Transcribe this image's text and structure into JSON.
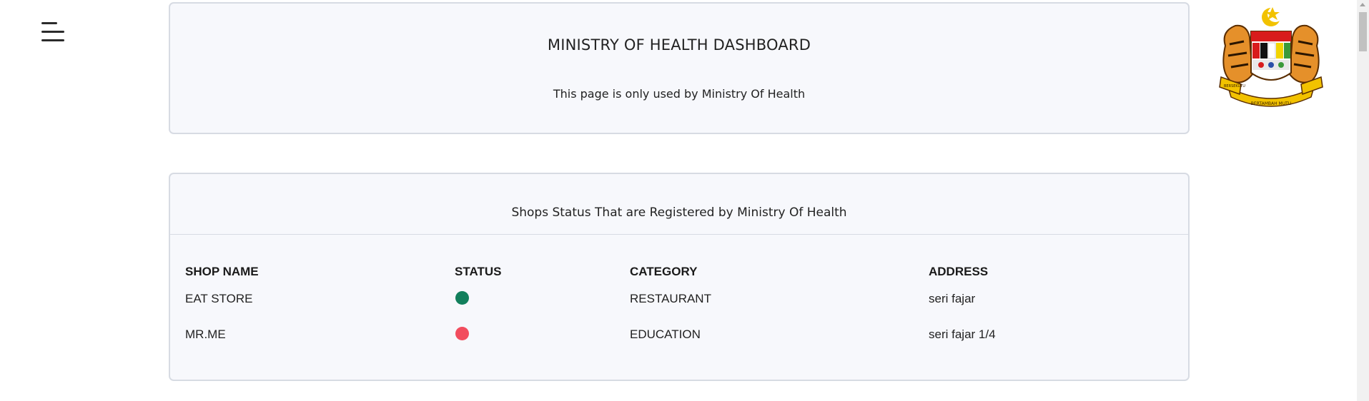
{
  "header": {
    "title": "MINISTRY OF HEALTH DASHBOARD",
    "subtitle": "This page is only used by Ministry Of Health"
  },
  "shops": {
    "heading": "Shops Status That are Registered by Ministry Of Health",
    "columns": [
      "SHOP NAME",
      "STATUS",
      "CATEGORY",
      "ADDRESS"
    ],
    "rows": [
      {
        "name": "EAT STORE",
        "status_color": "#127f5c",
        "category": "RESTAURANT",
        "address": "seri fajar"
      },
      {
        "name": "MR.ME",
        "status_color": "#f24d5e",
        "category": "EDUCATION",
        "address": "seri fajar 1/4"
      }
    ]
  },
  "icons": {
    "menu": "hamburger-menu-icon",
    "logo": "malaysia-coat-of-arms-logo"
  },
  "logo_text": {
    "left_ribbon": "BERSEKUTU",
    "bottom_ribbon": "BERTAMBAH MUTU"
  },
  "colors": {
    "card_bg": "#f7f8fc",
    "card_border": "#d7dbe3",
    "status_active": "#127f5c",
    "status_inactive": "#f24d5e"
  }
}
